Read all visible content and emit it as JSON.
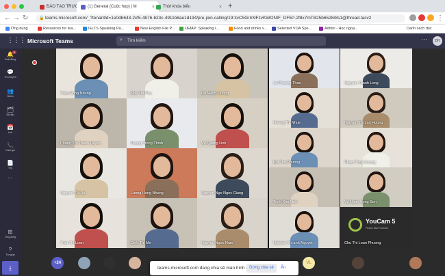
{
  "browser": {
    "tabs": [
      {
        "label": "ĐÀO TẠO TRỰC TUYẾN",
        "favicon_color": "#c9302c"
      },
      {
        "label": "(1) General (Cuộc họp) | M",
        "favicon_color": "#5b5fc7"
      },
      {
        "label": "Thời khóa biểu",
        "favicon_color": "#34a853"
      }
    ],
    "url": "teams.microsoft.com/_?tenantId=1e0db643-2cf5-4b76-b23c-4911b8ae1d194/pre-join-calling/19:3vC5GrIn9FzvKWONIF_DF5P-2f8x7mTB25b6528r8s1@thread.tacv2",
    "bookmarks": [
      {
        "label": "Ứng dụng",
        "color": "#4285f4"
      },
      {
        "label": "Resources for tea...",
        "color": "#e53935"
      },
      {
        "label": "IELTS Speaking Pa...",
        "color": "#1e88e5"
      },
      {
        "label": "New English File P...",
        "color": "#e53935"
      },
      {
        "label": "UEfAP: Speaking i...",
        "color": "#43a047"
      },
      {
        "label": "Food and drinks v...",
        "color": "#fb8c00"
      },
      {
        "label": "Selected VOA Spe...",
        "color": "#3949ab"
      },
      {
        "label": "Admin - Học ngoạ...",
        "color": "#8e24aa"
      }
    ],
    "bookmarks_other": "Danh sách đọc"
  },
  "teams": {
    "app_title": "Microsoft Teams",
    "search_placeholder": "Tìm kiếm",
    "user_initials": "DH",
    "rail": [
      {
        "label": "Hoạt động",
        "icon": "bell-icon",
        "badge": "3"
      },
      {
        "label": "Trò chuyện",
        "icon": "chat-icon"
      },
      {
        "label": "Nhóm",
        "icon": "teams-icon"
      },
      {
        "label": "Bài tập",
        "icon": "assignment-icon"
      },
      {
        "label": "Lịch",
        "icon": "calendar-icon"
      },
      {
        "label": "Cuộc gọi",
        "icon": "phone-icon"
      },
      {
        "label": "Tệp",
        "icon": "file-icon"
      },
      {
        "label": "...",
        "icon": "more-icon"
      },
      {
        "label": "Ứng dụng",
        "icon": "apps-icon"
      },
      {
        "label": "Trợ giúp",
        "icon": "help-icon"
      }
    ]
  },
  "participants": [
    {
      "name": "Trieu Hong Nhung"
    },
    {
      "name": "Nhe Thi Phu"
    },
    {
      "name": "Do Manh Cuong"
    },
    {
      "name": "Le Phuong Thao"
    },
    {
      "name": "Nguyen Thanh Long"
    },
    {
      "name": "Phung Thi Thanh Huyen"
    },
    {
      "name": "Hoang Trong Thinh"
    },
    {
      "name": "Vu Quang Linh"
    },
    {
      "name": "Hoang Thi Nhue"
    },
    {
      "name": "Nguyen Thi Lan Huong"
    },
    {
      "name": "Bui Thu Phuong"
    },
    {
      "name": "Pham Thuy Duong"
    },
    {
      "name": "Nguyen Thi Ha"
    },
    {
      "name": "Luong Hong Nhung"
    },
    {
      "name": "Nguyen Ngo Ngoc Giang"
    },
    {
      "name": "Trinh Kim Linh"
    },
    {
      "name": "Vu Ngoc Hong Son"
    },
    {
      "name": "Tran Thi Loan"
    },
    {
      "name": "Dinh Thi Me"
    },
    {
      "name": "Nguyen Ngoc Nam"
    },
    {
      "name": "Nghiem Thi anh Nguyet"
    },
    {
      "name": "Chu Thi Loan Phuong"
    }
  ],
  "youcam": {
    "title": "YouCam 5",
    "subtitle": "Please Start YouCam"
  },
  "roster_strip": {
    "overflow_count": "+24",
    "initials_avatar": "VL"
  },
  "screen_share_bar": {
    "message": "teams.microsoft.com đang chia sẻ màn hình của bạn.",
    "stop_label": "Dừng chia sẻ",
    "hide_label": "Ẩn"
  }
}
